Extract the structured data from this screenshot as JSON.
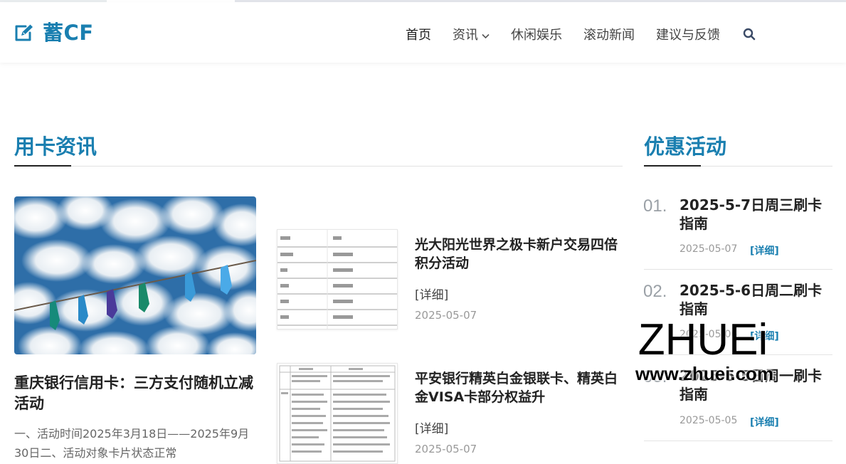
{
  "site": {
    "logo_text": "蓄CF",
    "logo_icon": "edit-icon",
    "brand_color": "#1a7fb0"
  },
  "nav": {
    "items": [
      {
        "label": "首页",
        "active": true
      },
      {
        "label": "资讯",
        "dropdown": true
      },
      {
        "label": "休闲娱乐"
      },
      {
        "label": "滚动新闻"
      },
      {
        "label": "建议与反馈"
      }
    ],
    "search_icon": "search-icon"
  },
  "main": {
    "section_title": "用卡资讯",
    "featured": {
      "image": "clothespins-sky-image",
      "title": "重庆银行信用卡：三方支付随机立减活动",
      "excerpt": "一、活动时间2025年3月18日——2025年9月30日二、活动对象卡片状态正常"
    },
    "articles": [
      {
        "title": "光大阳光世界之极卡新户交易四倍积分活动",
        "more": "[详细]",
        "date": "2025-05-07",
        "thumb": "table-document-thumbnail"
      },
      {
        "title": "平安银行精英白金银联卡、精英白金VISA卡部分权益升",
        "more": "[详细]",
        "date": "2025-05-07",
        "thumb": "text-document-thumbnail"
      }
    ]
  },
  "sidebar": {
    "section_title": "优惠活动",
    "items": [
      {
        "num": "01.",
        "title": "2025-5-7日周三刷卡指南",
        "date": "2025-05-07",
        "detail": "[详细]"
      },
      {
        "num": "02.",
        "title": "2025-5-6日周二刷卡指南",
        "date": "2025-05-06",
        "detail": "[详细]"
      },
      {
        "num": "03.",
        "title": "2025-5-5日周一刷卡指南",
        "date": "2025-05-05",
        "detail": "[详细]"
      }
    ]
  },
  "watermark": {
    "big": "ZHUEi",
    "small": "www.zhuei.com"
  }
}
